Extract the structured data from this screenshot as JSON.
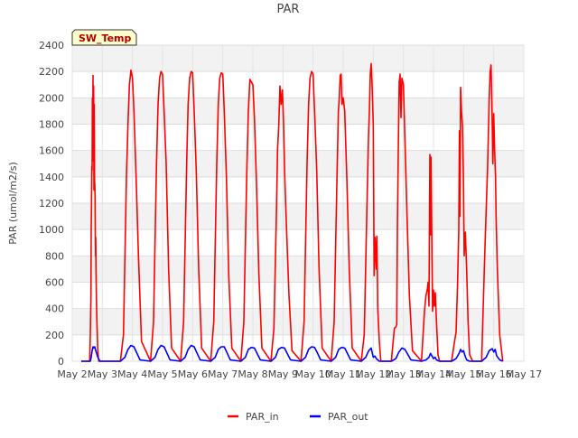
{
  "chart_data": {
    "type": "line",
    "title": "PAR",
    "xlabel": "",
    "ylabel": "PAR (umol/m2/s)",
    "badge": "SW_Temp",
    "xlim": [
      2,
      17
    ],
    "ylim": [
      0,
      2400
    ],
    "x_ticks": [
      2,
      3,
      4,
      5,
      6,
      7,
      8,
      9,
      10,
      11,
      12,
      13,
      14,
      15,
      16,
      17
    ],
    "x_tick_labels": [
      "May 2",
      "May 3",
      "May 4",
      "May 5",
      "May 6",
      "May 7",
      "May 8",
      "May 9",
      "May 10",
      "May 11",
      "May 12",
      "May 13",
      "May 14",
      "May 15",
      "May 16",
      "May 17"
    ],
    "y_ticks": [
      0,
      200,
      400,
      600,
      800,
      1000,
      1200,
      1400,
      1600,
      1800,
      2000,
      2200,
      2400
    ],
    "y_tick_labels": [
      "0",
      "200",
      "400",
      "600",
      "800",
      "1000",
      "1200",
      "1400",
      "1600",
      "1800",
      "2000",
      "2200",
      "2400"
    ],
    "grid": true,
    "legend_position": "bottom-center",
    "series": [
      {
        "name": "PAR_in",
        "color": "#ff0000",
        "x": [
          2.3,
          2.58,
          2.6,
          2.62,
          2.63,
          2.64,
          2.65,
          2.66,
          2.67,
          2.68,
          2.69,
          2.7,
          2.71,
          2.72,
          2.73,
          2.74,
          2.75,
          2.76,
          2.77,
          2.78,
          2.79,
          2.8,
          2.82,
          2.85,
          2.88,
          2.92,
          3.3,
          3.6,
          3.7,
          3.8,
          3.85,
          3.9,
          3.95,
          4.0,
          4.05,
          4.12,
          4.2,
          4.3,
          4.6,
          4.6,
          4.7,
          4.8,
          4.85,
          4.9,
          4.95,
          5.0,
          5.05,
          5.12,
          5.2,
          5.3,
          5.6,
          5.6,
          5.7,
          5.8,
          5.85,
          5.9,
          5.95,
          6.0,
          6.05,
          6.12,
          6.2,
          6.3,
          6.6,
          6.6,
          6.7,
          6.8,
          6.85,
          6.9,
          6.95,
          7.0,
          7.05,
          7.12,
          7.2,
          7.3,
          7.6,
          7.6,
          7.7,
          7.8,
          7.85,
          7.9,
          7.95,
          8.0,
          8.05,
          8.12,
          8.2,
          8.3,
          8.6,
          8.6,
          8.7,
          8.78,
          8.82,
          8.86,
          8.9,
          8.94,
          8.98,
          9.02,
          9.06,
          9.12,
          9.2,
          9.3,
          9.6,
          9.6,
          9.7,
          9.8,
          9.85,
          9.9,
          9.95,
          10.0,
          10.05,
          10.12,
          10.2,
          10.3,
          10.6,
          10.6,
          10.7,
          10.8,
          10.84,
          10.87,
          10.9,
          10.93,
          10.96,
          11.0,
          11.05,
          11.12,
          11.2,
          11.3,
          11.6,
          11.6,
          11.7,
          11.8,
          11.84,
          11.87,
          11.9,
          11.93,
          11.96,
          12.0,
          12.03,
          12.06,
          12.1,
          12.12,
          12.15,
          12.2,
          12.25,
          12.6,
          12.6,
          12.7,
          12.75,
          12.78,
          12.8,
          12.83,
          12.86,
          12.89,
          12.92,
          12.95,
          13.0,
          13.05,
          13.12,
          13.2,
          13.3,
          13.6,
          13.6,
          13.7,
          13.75,
          13.8,
          13.82,
          13.85,
          13.87,
          13.88,
          13.9,
          13.92,
          13.95,
          13.97,
          14.0,
          14.03,
          14.06,
          14.1,
          14.15,
          14.2,
          14.3,
          14.6,
          14.6,
          14.7,
          14.75,
          14.8,
          14.84,
          14.86,
          14.88,
          14.9,
          14.93,
          14.96,
          14.99,
          15.02,
          15.06,
          15.1,
          15.15,
          15.2,
          15.3,
          15.6,
          15.6,
          15.7,
          15.8,
          15.85,
          15.88,
          15.91,
          15.94,
          15.97,
          16.0,
          16.03,
          16.06,
          16.08,
          16.12,
          16.2,
          16.3
        ],
        "y": [
          0,
          0,
          200,
          500,
          1000,
          1200,
          1480,
          1450,
          2000,
          1700,
          2170,
          1520,
          2090,
          1300,
          1950,
          1370,
          1340,
          1250,
          800,
          940,
          700,
          500,
          300,
          80,
          0,
          0,
          0,
          0,
          200,
          1400,
          1800,
          2100,
          2210,
          2150,
          1900,
          1400,
          800,
          150,
          0,
          0,
          300,
          1500,
          1950,
          2150,
          2200,
          2180,
          1900,
          1500,
          700,
          100,
          0,
          0,
          300,
          1500,
          1950,
          2150,
          2200,
          2190,
          1900,
          1450,
          700,
          100,
          0,
          0,
          300,
          1500,
          1950,
          2150,
          2190,
          2180,
          1900,
          1400,
          650,
          100,
          0,
          0,
          300,
          1450,
          1900,
          2140,
          2120,
          2100,
          1850,
          1350,
          650,
          100,
          0,
          0,
          250,
          1100,
          1600,
          1800,
          2090,
          1950,
          2060,
          1800,
          1400,
          1000,
          500,
          80,
          0,
          0,
          300,
          1500,
          1950,
          2150,
          2200,
          2180,
          1900,
          1450,
          700,
          100,
          0,
          0,
          300,
          1450,
          1900,
          2000,
          2170,
          2180,
          1950,
          2000,
          1900,
          1400,
          700,
          100,
          0,
          0,
          200,
          1300,
          1700,
          1900,
          2180,
          2260,
          2100,
          1800,
          650,
          940,
          700,
          950,
          400,
          150,
          0,
          0,
          0,
          250,
          260,
          280,
          1000,
          1600,
          2120,
          2180,
          1850,
          2150,
          2100,
          1700,
          1100,
          500,
          80,
          0,
          0,
          380,
          500,
          550,
          600,
          420,
          1250,
          1570,
          960,
          1550,
          800,
          380,
          540,
          420,
          520,
          300,
          50,
          0,
          0,
          0,
          0,
          150,
          220,
          600,
          1000,
          1750,
          1100,
          2080,
          1900,
          1800,
          1450,
          800,
          980,
          700,
          300,
          50,
          0,
          0,
          0,
          800,
          1500,
          2000,
          2200,
          2250,
          1950,
          1500,
          1880,
          1600,
          1400,
          1100,
          700,
          200,
          0
        ]
      },
      {
        "name": "PAR_out",
        "color": "#0000ff",
        "x": [
          2.3,
          2.6,
          2.63,
          2.66,
          2.69,
          2.72,
          2.75,
          2.78,
          2.81,
          2.85,
          2.92,
          3.6,
          3.75,
          3.85,
          3.95,
          4.05,
          4.15,
          4.25,
          4.6,
          4.75,
          4.85,
          4.95,
          5.05,
          5.15,
          5.25,
          5.6,
          5.75,
          5.85,
          5.95,
          6.05,
          6.15,
          6.25,
          6.6,
          6.75,
          6.85,
          6.95,
          7.05,
          7.15,
          7.25,
          7.6,
          7.75,
          7.85,
          7.95,
          8.05,
          8.15,
          8.25,
          8.6,
          8.75,
          8.85,
          8.95,
          9.05,
          9.15,
          9.25,
          9.6,
          9.75,
          9.85,
          9.95,
          10.05,
          10.15,
          10.25,
          10.6,
          10.75,
          10.85,
          10.95,
          11.05,
          11.15,
          11.25,
          11.6,
          11.75,
          11.85,
          11.93,
          12.0,
          12.05,
          12.1,
          12.2,
          12.6,
          12.75,
          12.85,
          12.95,
          13.05,
          13.15,
          13.25,
          13.6,
          13.75,
          13.85,
          13.9,
          13.95,
          14.0,
          14.05,
          14.1,
          14.2,
          14.6,
          14.75,
          14.85,
          14.9,
          14.95,
          15.0,
          15.05,
          15.1,
          15.2,
          15.6,
          15.75,
          15.85,
          15.95,
          16.0,
          16.05,
          16.1,
          16.2,
          16.3
        ],
        "y": [
          0,
          0,
          30,
          80,
          110,
          100,
          110,
          80,
          60,
          30,
          0,
          0,
          30,
          90,
          120,
          110,
          60,
          10,
          0,
          30,
          90,
          120,
          110,
          60,
          10,
          0,
          30,
          90,
          120,
          110,
          60,
          10,
          0,
          30,
          90,
          110,
          110,
          60,
          10,
          0,
          30,
          90,
          105,
          100,
          55,
          10,
          0,
          30,
          90,
          105,
          100,
          55,
          10,
          0,
          30,
          90,
          110,
          105,
          60,
          10,
          0,
          30,
          90,
          105,
          100,
          55,
          10,
          0,
          30,
          80,
          100,
          30,
          40,
          20,
          0,
          0,
          20,
          70,
          100,
          90,
          50,
          10,
          0,
          10,
          30,
          60,
          40,
          20,
          30,
          10,
          0,
          0,
          20,
          60,
          90,
          70,
          80,
          40,
          10,
          0,
          0,
          30,
          80,
          95,
          70,
          90,
          40,
          10,
          0
        ]
      }
    ]
  }
}
